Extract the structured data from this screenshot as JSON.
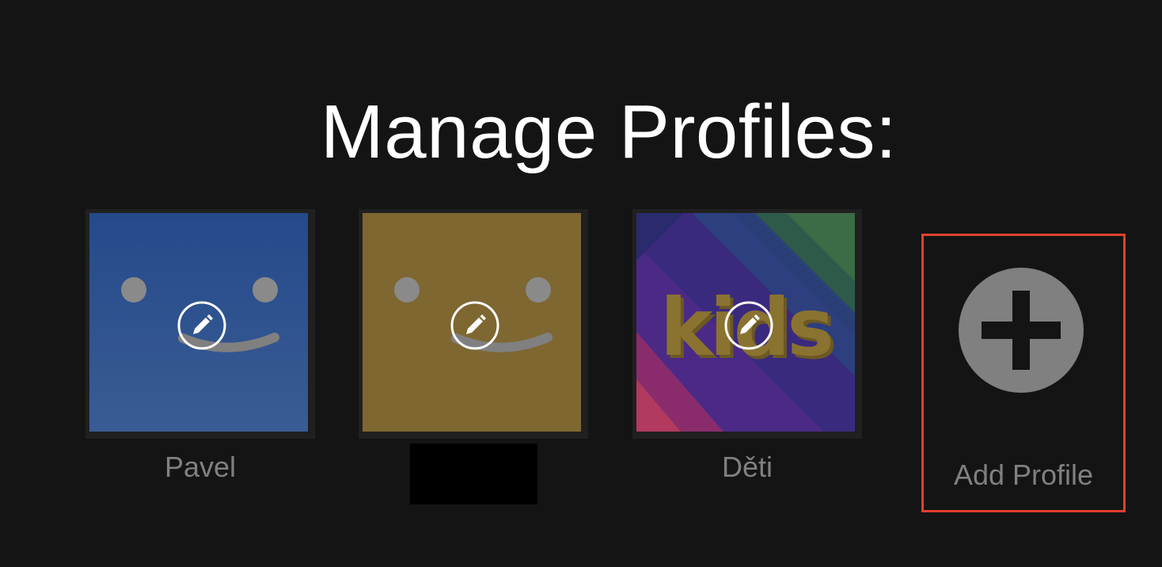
{
  "page": {
    "title": "Manage Profiles:"
  },
  "profiles": [
    {
      "name": "Pavel",
      "avatar": "smiley-blue",
      "color": "#2a4f8f",
      "edit_icon": "pencil-icon"
    },
    {
      "name": "",
      "avatar": "smiley-yellow",
      "color": "#7f6730",
      "edit_icon": "pencil-icon",
      "name_redacted": true
    },
    {
      "name": "Děti",
      "avatar": "kids",
      "avatar_text": "kids",
      "edit_icon": "pencil-icon"
    }
  ],
  "add_profile": {
    "label": "Add Profile",
    "icon": "plus-circle-icon",
    "highlight_color": "#e0402e"
  }
}
